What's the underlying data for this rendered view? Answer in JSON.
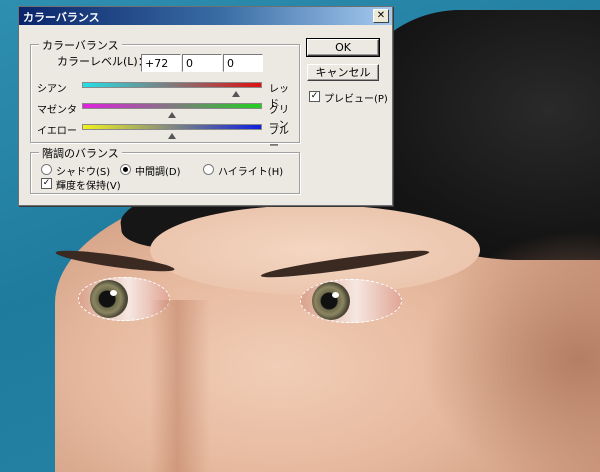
{
  "dialog": {
    "title": "カラーバランス",
    "close_glyph": "✕",
    "color_balance": {
      "group_label": "カラーバランス",
      "level_label": "カラーレベル(L)：",
      "levels": [
        "+72",
        "0",
        "0"
      ],
      "sliders": [
        {
          "left": "シアン",
          "right": "レッド",
          "value": 72
        },
        {
          "left": "マゼンタ",
          "right": "グリーン",
          "value": 0
        },
        {
          "left": "イエロー",
          "right": "ブルー",
          "value": 0
        }
      ]
    },
    "tone_balance": {
      "group_label": "階調のバランス",
      "options": [
        {
          "label": "シャドウ(S)",
          "selected": false
        },
        {
          "label": "中間調(D)",
          "selected": true
        },
        {
          "label": "ハイライト(H)",
          "selected": false
        }
      ],
      "preserve_luminosity": {
        "label": "輝度を保持(V)",
        "checked": true
      }
    },
    "buttons": {
      "ok": "OK",
      "cancel": "キャンセル"
    },
    "preview": {
      "label": "プレビュー(P)",
      "checked": true
    },
    "check_glyph": "✓"
  },
  "colors": {
    "title_start": "#0a246a",
    "title_end": "#a6caf0",
    "background_teal": "#2f8fb0"
  },
  "icons": [
    "close-icon",
    "check-icon",
    "radio-icon",
    "slider-thumb-icon"
  ]
}
